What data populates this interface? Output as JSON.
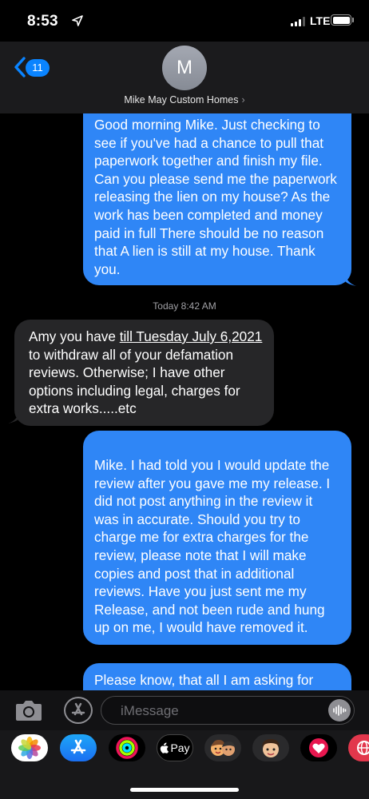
{
  "status_bar": {
    "time": "8:53",
    "network": "LTE"
  },
  "header": {
    "back_count": "11",
    "avatar_initial": "M",
    "contact_name": "Mike May Custom Homes",
    "contact_chevron": "›"
  },
  "messages": [
    {
      "direction": "outgoing",
      "text": "Good morning Mike. Just checking to see if you've had a chance to pull that paperwork together and finish my file. Can you please send me the paperwork releasing the lien on my house? As the work has been completed and money paid in full There should be no reason that A lien is still at my house. Thank you."
    },
    {
      "direction": "incoming",
      "text_before": "Amy you have ",
      "text_link": "till Tuesday July 6,2021",
      "text_after": " to withdraw all of your defamation reviews.  Otherwise; I have other options including legal, charges for extra works.....etc"
    },
    {
      "direction": "outgoing",
      "text": "Mike.  I had told you I would update the review after you gave me my release. I did not post anything in the review it was in accurate. Should you try to charge me for extra charges for the review, please note that I will make copies and post that in additional reviews. Have you just sent me my Release, and not been rude and hung up on me, I would have removed it."
    },
    {
      "direction": "outgoing",
      "text": "Please know, that all I am asking for"
    }
  ],
  "timestamp": {
    "label": "Today",
    "time": "8:42 AM"
  },
  "compose": {
    "placeholder": "iMessage"
  },
  "app_drawer": {
    "apps": [
      {
        "name": "photos",
        "icon": "photos-icon"
      },
      {
        "name": "app-store",
        "icon": "app-store-icon"
      },
      {
        "name": "activity",
        "icon": "activity-icon"
      },
      {
        "name": "apple-pay",
        "icon": "apple-pay-icon",
        "label": "Pay"
      },
      {
        "name": "memoji-stickers",
        "icon": "memoji-icon"
      },
      {
        "name": "animoji",
        "icon": "animoji-icon"
      },
      {
        "name": "digital-touch",
        "icon": "digital-touch-icon"
      },
      {
        "name": "search-images",
        "icon": "images-search-icon"
      }
    ]
  },
  "colors": {
    "outgoing_bubble": "#2f86f6",
    "incoming_bubble": "#262628",
    "accent": "#0a84ff"
  }
}
